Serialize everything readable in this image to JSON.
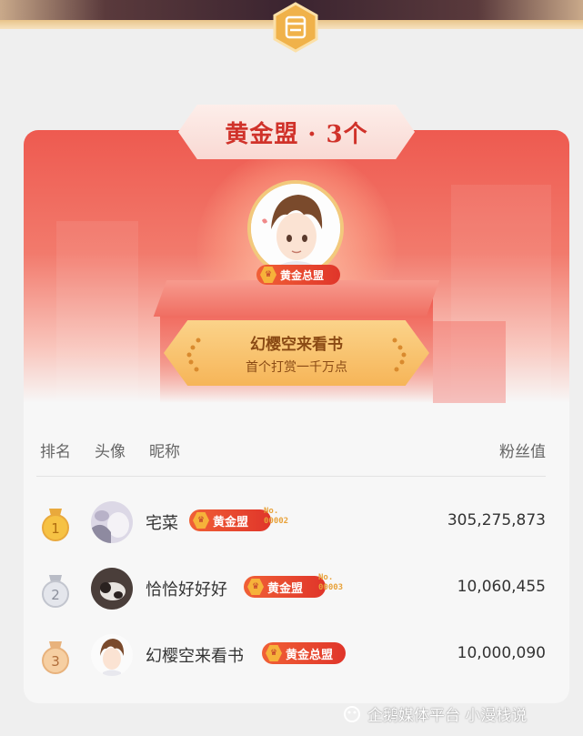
{
  "header": {
    "title": "黄金盟 · 3个"
  },
  "top_supporter": {
    "badge": "黄金总盟",
    "name": "幻樱空来看书",
    "subtitle": "首个打赏一千万点"
  },
  "table": {
    "columns": {
      "rank": "排名",
      "avatar": "头像",
      "nickname": "昵称",
      "fans_value": "粉丝值"
    },
    "rows": [
      {
        "rank": "1",
        "name": "宅菜",
        "badge": "黄金盟",
        "no_label": "No.",
        "no": "00002",
        "value": "305,275,873"
      },
      {
        "rank": "2",
        "name": "恰恰好好好",
        "badge": "黄金盟",
        "no_label": "No.",
        "no": "00003",
        "value": "10,060,455"
      },
      {
        "rank": "3",
        "name": "幻樱空来看书",
        "badge": "黄金总盟",
        "no_label": "",
        "no": "",
        "value": "10,000,090"
      }
    ]
  },
  "watermark": {
    "text": "企鹅媒体平台 小漫栈说"
  },
  "colors": {
    "accent_red": "#e0352a",
    "gold": "#f6b23a"
  }
}
